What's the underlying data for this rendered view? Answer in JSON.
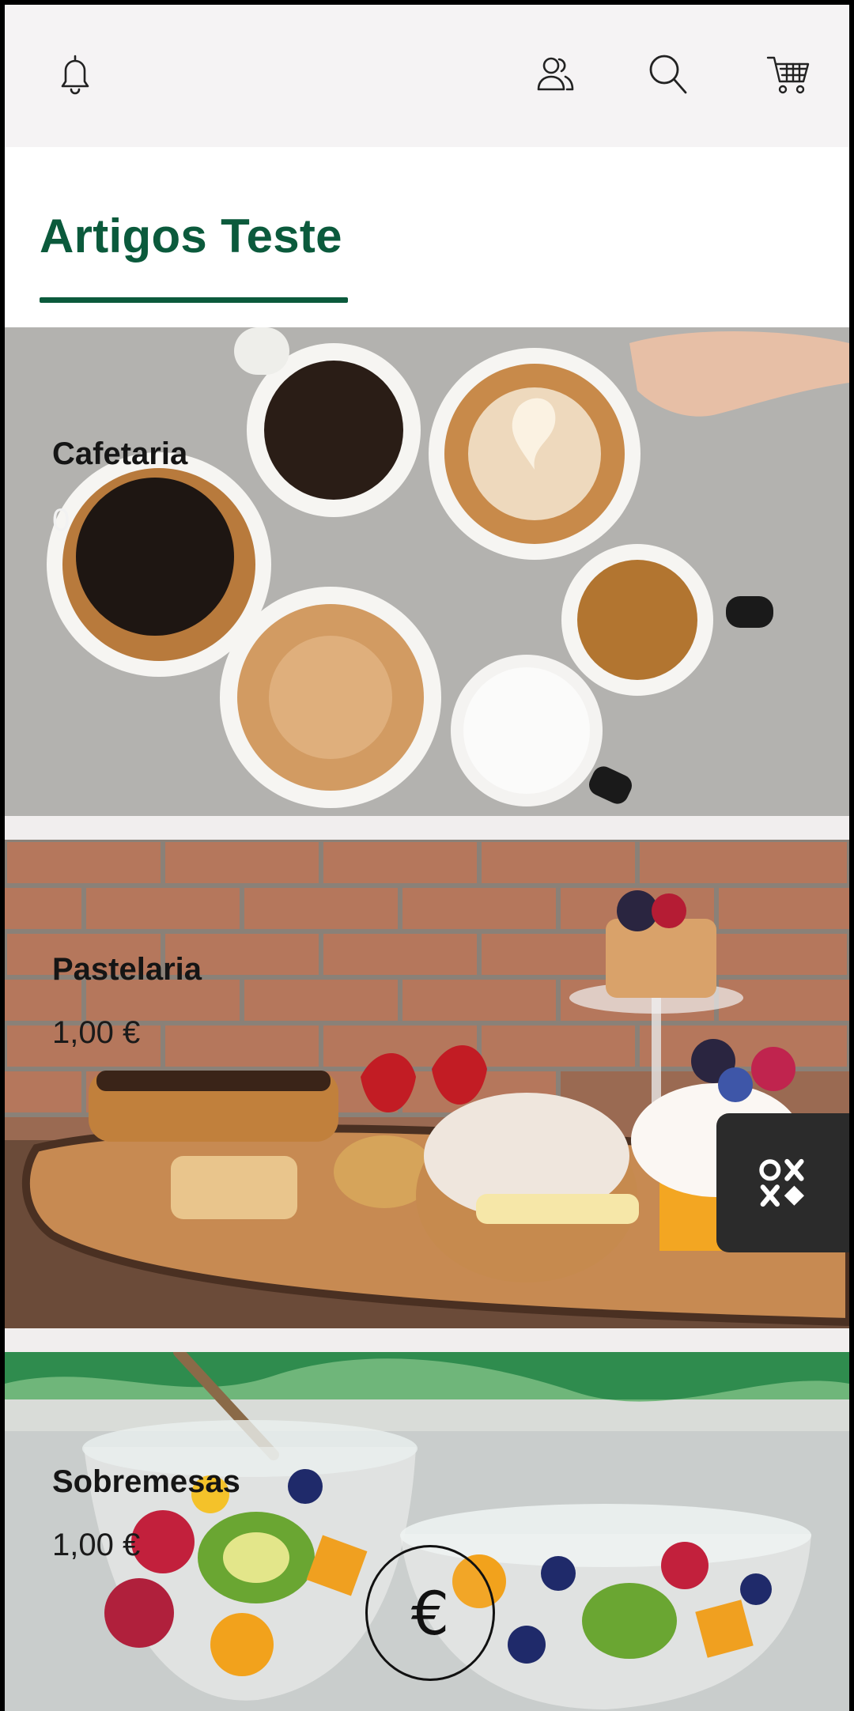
{
  "header": {
    "icons": [
      "bell-icon",
      "users-icon",
      "search-icon",
      "cart-icon"
    ]
  },
  "page": {
    "title": "Artigos Teste"
  },
  "categories": [
    {
      "name": "Cafetaria",
      "price": "0",
      "image": "coffee-cups"
    },
    {
      "name": "Pastelaria",
      "price": "1,00 €",
      "image": "pastries"
    },
    {
      "name": "Sobremesas",
      "price": "1,00 €",
      "image": "fruit-salad"
    }
  ],
  "floating": {
    "widget_icon": "oxxo-logo-icon",
    "currency_symbol": "€"
  },
  "colors": {
    "accent": "#0b5a3c",
    "topbar": "#f5f3f4",
    "divider": "#f1eeee"
  }
}
